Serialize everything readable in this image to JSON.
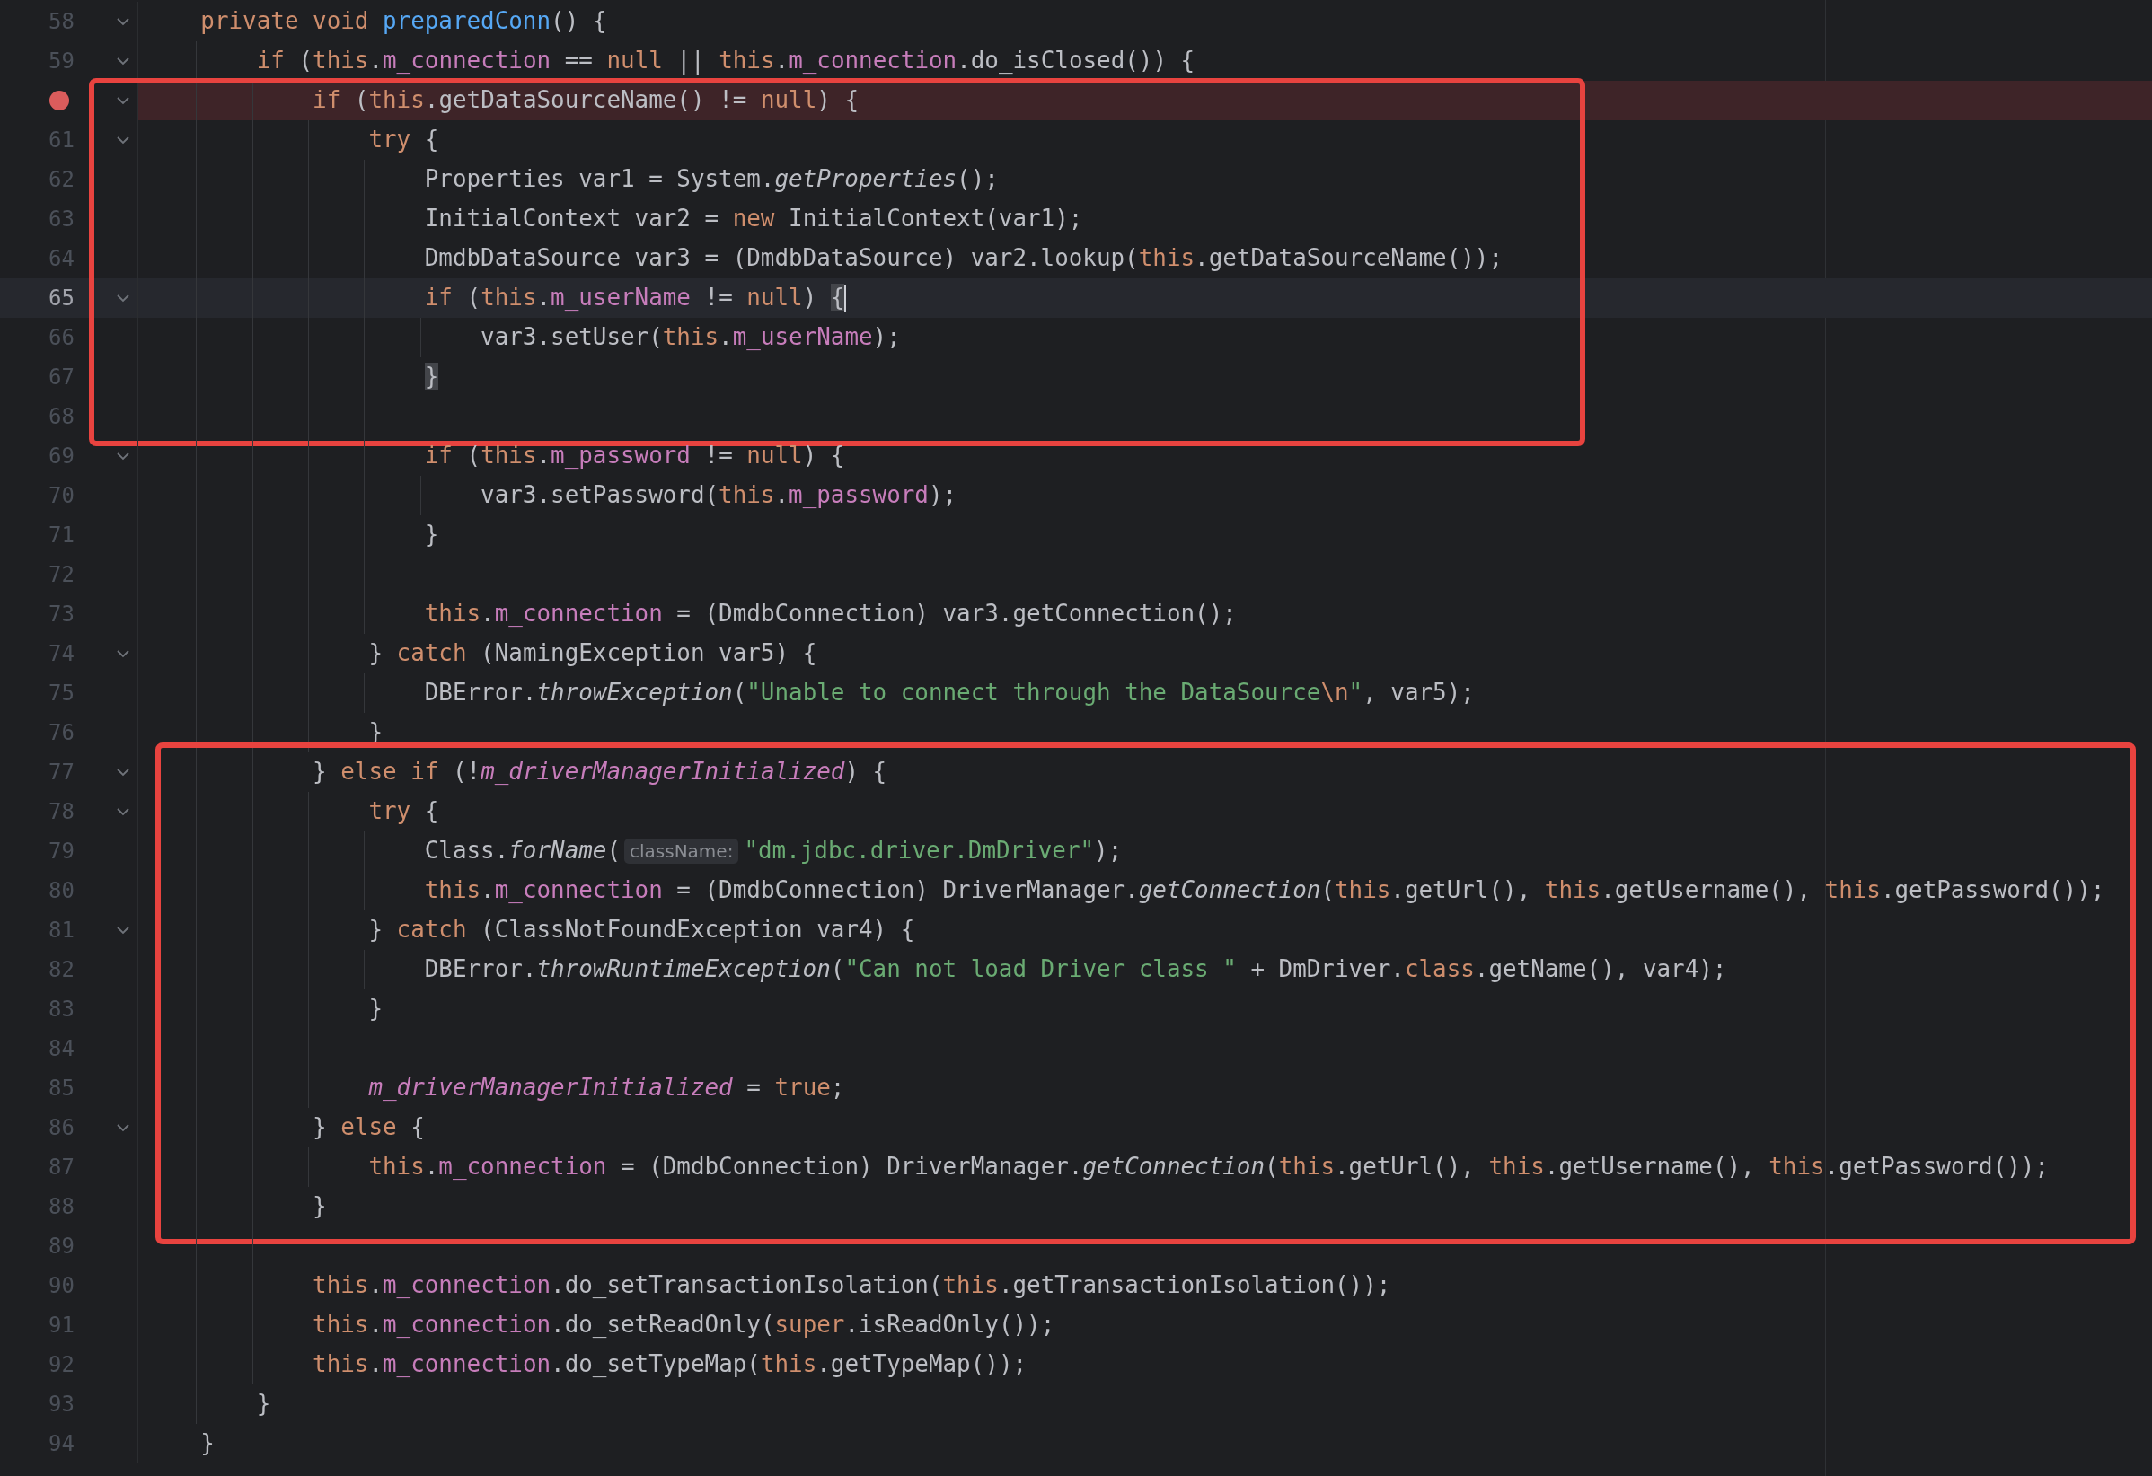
{
  "editor": {
    "blocks": [
      {
        "lines": [
          {
            "number": "58",
            "fold": true,
            "tokens": [
              {
                "text": "    private void ",
                "kind": "keyword"
              },
              {
                "text": "preparedConn",
                "kind": "declaration"
              },
              {
                "text": "() {",
                "kind": "plain"
              }
            ]
          },
          {
            "number": "59",
            "fold": true,
            "tokens": [
              {
                "text": "        if",
                "kind": "keyword"
              },
              {
                "text": " (",
                "kind": "plain"
              },
              {
                "text": "this",
                "kind": "keyword"
              },
              {
                "text": ".m_connection",
                "kind": "field-access"
              },
              {
                "text": " == ",
                "kind": "plain"
              },
              {
                "text": "null",
                "kind": "keyword"
              },
              {
                "text": " || ",
                "kind": "plain"
              },
              {
                "text": "this",
                "kind": "keyword"
              },
              {
                "text": ".m_connection",
                "kind": "field-access"
              },
              {
                "text": ".do_isClosed()) {",
                "kind": "plain"
              }
            ]
          }
        ]
      },
      {
        "kind": "inset-box",
        "lines": [
          {
            "breakpoint": true,
            "fold": true,
            "tokens": [
              {
                "text": "            if",
                "kind": "keyword"
              },
              {
                "text": " (",
                "kind": "plain"
              },
              {
                "text": "this",
                "kind": "keyword"
              },
              {
                "text": ".getDataSourceName() != ",
                "kind": "plain"
              },
              {
                "text": "null",
                "kind": "keyword"
              },
              {
                "text": ") {",
                "kind": "plain"
              }
            ]
          },
          {
            "number": "61",
            "fold": true,
            "tokens": [
              {
                "text": "                try",
                "kind": "keyword"
              },
              {
                "text": " {",
                "kind": "plain"
              }
            ]
          },
          {
            "number": "62",
            "fold": false,
            "tokens": [
              {
                "text": "                    Properties var1 = System.",
                "kind": "plain"
              },
              {
                "text": "getProperties",
                "kind": "static-call"
              },
              {
                "text": "();",
                "kind": "plain"
              }
            ]
          },
          {
            "number": "63",
            "fold": false,
            "tokens": [
              {
                "text": "                    InitialContext var2 = ",
                "kind": "plain"
              },
              {
                "text": "new",
                "kind": "keyword"
              },
              {
                "text": " InitialContext(var1);",
                "kind": "plain"
              }
            ]
          },
          {
            "number": "64",
            "fold": false,
            "tokens": [
              {
                "text": "                    DmdbDataSource var3 = (DmdbDataSource) var2.lookup(",
                "kind": "plain"
              },
              {
                "text": "this",
                "kind": "keyword"
              },
              {
                "text": ".getDataSourceName());",
                "kind": "plain"
              }
            ]
          },
          {
            "number": "65",
            "fold": true,
            "current": true,
            "caret": true,
            "tokens": [
              {
                "text": "                    if",
                "kind": "keyword"
              },
              {
                "text": " (",
                "kind": "plain"
              },
              {
                "text": "this",
                "kind": "keyword"
              },
              {
                "text": ".m_userName",
                "kind": "field-access"
              },
              {
                "text": " != ",
                "kind": "plain"
              },
              {
                "text": "null",
                "kind": "keyword"
              },
              {
                "text": ") ",
                "kind": "plain"
              },
              {
                "text": "{",
                "kind": "brace-match"
              }
            ]
          },
          {
            "number": "66",
            "fold": false,
            "tokens": [
              {
                "text": "                        var3.setUser(",
                "kind": "plain"
              },
              {
                "text": "this",
                "kind": "keyword"
              },
              {
                "text": ".m_userName",
                "kind": "field-access"
              },
              {
                "text": ");",
                "kind": "plain"
              }
            ]
          },
          {
            "number": "67",
            "fold": false,
            "tokens": [
              {
                "text": "                    }",
                "kind": "brace-match"
              }
            ]
          },
          {
            "number": "68",
            "fold": false
          }
        ]
      },
      {
        "lines": [
          {
            "number": "69",
            "fold": true,
            "tokens": [
              {
                "text": "                    if",
                "kind": "keyword"
              },
              {
                "text": " (",
                "kind": "plain"
              },
              {
                "text": "this",
                "kind": "keyword"
              },
              {
                "text": ".m_password",
                "kind": "field-access"
              },
              {
                "text": " != ",
                "kind": "plain"
              },
              {
                "text": "null",
                "kind": "keyword"
              },
              {
                "text": ") {",
                "kind": "plain"
              }
            ]
          },
          {
            "number": "70",
            "fold": false,
            "tokens": [
              {
                "text": "                        var3.setPassword(",
                "kind": "plain"
              },
              {
                "text": "this",
                "kind": "keyword"
              },
              {
                "text": ".m_password",
                "kind": "field-access"
              },
              {
                "text": ");",
                "kind": "plain"
              }
            ]
          },
          {
            "number": "71",
            "fold": false,
            "tokens": [
              {
                "text": "                    }",
                "kind": "plain"
              }
            ]
          },
          {
            "number": "72",
            "fold": false
          },
          {
            "number": "73",
            "fold": false,
            "tokens": [
              {
                "text": "                    this",
                "kind": "keyword"
              },
              {
                "text": ".m_connection",
                "kind": "field-access"
              },
              {
                "text": " = (DmdbConnection) var3.getConnection();",
                "kind": "plain"
              }
            ]
          },
          {
            "number": "74",
            "fold": true,
            "tokens": [
              {
                "text": "                } ",
                "kind": "plain"
              },
              {
                "text": "catch",
                "kind": "keyword"
              },
              {
                "text": " (NamingException var5) {",
                "kind": "plain"
              }
            ]
          },
          {
            "number": "75",
            "fold": false,
            "tokens": [
              {
                "text": "                    DBError.",
                "kind": "plain"
              },
              {
                "text": "throwException",
                "kind": "static-call"
              },
              {
                "text": "(",
                "kind": "plain"
              },
              {
                "text": "\"Unable to connect through the DataSource",
                "kind": "string"
              },
              {
                "text": "\\n",
                "kind": "escape"
              },
              {
                "text": "\"",
                "kind": "string"
              },
              {
                "text": ", var5);",
                "kind": "plain"
              }
            ]
          },
          {
            "number": "76",
            "fold": false,
            "tokens": [
              {
                "text": "                }",
                "kind": "plain"
              }
            ]
          }
        ]
      },
      {
        "kind": "wide-box",
        "lines": [
          {
            "number": "77",
            "fold": true,
            "tokens": [
              {
                "text": "            } ",
                "kind": "plain"
              },
              {
                "text": "else if",
                "kind": "keyword"
              },
              {
                "text": " (!",
                "kind": "plain"
              },
              {
                "text": "m_driverManagerInitialized",
                "kind": "static-field"
              },
              {
                "text": ") {",
                "kind": "plain"
              }
            ]
          },
          {
            "number": "78",
            "fold": true,
            "tokens": [
              {
                "text": "                try",
                "kind": "keyword"
              },
              {
                "text": " {",
                "kind": "plain"
              }
            ]
          },
          {
            "number": "79",
            "fold": false,
            "tokens": [
              {
                "text": "                    Class.",
                "kind": "plain"
              },
              {
                "text": "forName",
                "kind": "static-call"
              },
              {
                "text": "(",
                "kind": "plain"
              },
              {
                "text": "className:",
                "kind": "hint"
              },
              {
                "text": "\"dm.jdbc.driver.DmDriver\"",
                "kind": "string"
              },
              {
                "text": ");",
                "kind": "plain"
              }
            ]
          },
          {
            "number": "80",
            "fold": false,
            "tokens": [
              {
                "text": "                    this",
                "kind": "keyword"
              },
              {
                "text": ".m_connection",
                "kind": "field-access"
              },
              {
                "text": " = (DmdbConnection) DriverManager.",
                "kind": "plain"
              },
              {
                "text": "getConnection",
                "kind": "static-call"
              },
              {
                "text": "(",
                "kind": "plain"
              },
              {
                "text": "this",
                "kind": "keyword"
              },
              {
                "text": ".getUrl(), ",
                "kind": "plain"
              },
              {
                "text": "this",
                "kind": "keyword"
              },
              {
                "text": ".getUsername(), ",
                "kind": "plain"
              },
              {
                "text": "this",
                "kind": "keyword"
              },
              {
                "text": ".getPassword());",
                "kind": "plain"
              }
            ]
          },
          {
            "number": "81",
            "fold": true,
            "tokens": [
              {
                "text": "                } ",
                "kind": "plain"
              },
              {
                "text": "catch",
                "kind": "keyword"
              },
              {
                "text": " (ClassNotFoundException var4) {",
                "kind": "plain"
              }
            ]
          },
          {
            "number": "82",
            "fold": false,
            "tokens": [
              {
                "text": "                    DBError.",
                "kind": "plain"
              },
              {
                "text": "throwRuntimeException",
                "kind": "static-call"
              },
              {
                "text": "(",
                "kind": "plain"
              },
              {
                "text": "\"Can not load Driver class \"",
                "kind": "string"
              },
              {
                "text": " + DmDriver.",
                "kind": "plain"
              },
              {
                "text": "class",
                "kind": "keyword"
              },
              {
                "text": ".getName(), var4);",
                "kind": "plain"
              }
            ]
          },
          {
            "number": "83",
            "fold": false,
            "tokens": [
              {
                "text": "                }",
                "kind": "plain"
              }
            ]
          },
          {
            "number": "84",
            "fold": false
          },
          {
            "number": "85",
            "fold": false,
            "tokens": [
              {
                "text": "                m_driverManagerInitialized",
                "kind": "static-field"
              },
              {
                "text": " = ",
                "kind": "plain"
              },
              {
                "text": "true",
                "kind": "keyword"
              },
              {
                "text": ";",
                "kind": "plain"
              }
            ]
          },
          {
            "number": "86",
            "fold": true,
            "tokens": [
              {
                "text": "            } ",
                "kind": "plain"
              },
              {
                "text": "else",
                "kind": "keyword"
              },
              {
                "text": " {",
                "kind": "plain"
              }
            ]
          },
          {
            "number": "87",
            "fold": false,
            "tokens": [
              {
                "text": "                this",
                "kind": "keyword"
              },
              {
                "text": ".m_connection",
                "kind": "field-access"
              },
              {
                "text": " = (DmdbConnection) DriverManager.",
                "kind": "plain"
              },
              {
                "text": "getConnection",
                "kind": "static-call"
              },
              {
                "text": "(",
                "kind": "plain"
              },
              {
                "text": "this",
                "kind": "keyword"
              },
              {
                "text": ".getUrl(), ",
                "kind": "plain"
              },
              {
                "text": "this",
                "kind": "keyword"
              },
              {
                "text": ".getUsername(), ",
                "kind": "plain"
              },
              {
                "text": "this",
                "kind": "keyword"
              },
              {
                "text": ".getPassword());",
                "kind": "plain"
              }
            ]
          },
          {
            "number": "88",
            "fold": false,
            "tokens": [
              {
                "text": "            }",
                "kind": "plain"
              }
            ]
          }
        ]
      },
      {
        "lines": [
          {
            "number": "89",
            "fold": false
          },
          {
            "number": "90",
            "fold": false,
            "tokens": [
              {
                "text": "            this",
                "kind": "keyword"
              },
              {
                "text": ".m_connection",
                "kind": "field-access"
              },
              {
                "text": ".do_setTransactionIsolation(",
                "kind": "plain"
              },
              {
                "text": "this",
                "kind": "keyword"
              },
              {
                "text": ".getTransactionIsolation());",
                "kind": "plain"
              }
            ]
          },
          {
            "number": "91",
            "fold": false,
            "tokens": [
              {
                "text": "            this",
                "kind": "keyword"
              },
              {
                "text": ".m_connection",
                "kind": "field-access"
              },
              {
                "text": ".do_setReadOnly(",
                "kind": "plain"
              },
              {
                "text": "super",
                "kind": "keyword"
              },
              {
                "text": ".isReadOnly());",
                "kind": "plain"
              }
            ]
          },
          {
            "number": "92",
            "fold": false,
            "tokens": [
              {
                "text": "            this",
                "kind": "keyword"
              },
              {
                "text": ".m_connection",
                "kind": "field-access"
              },
              {
                "text": ".do_setTypeMap(",
                "kind": "plain"
              },
              {
                "text": "this",
                "kind": "keyword"
              },
              {
                "text": ".getTypeMap());",
                "kind": "plain"
              }
            ]
          },
          {
            "number": "93",
            "fold": false,
            "tokens": [
              {
                "text": "        }",
                "kind": "plain"
              }
            ]
          },
          {
            "number": "94",
            "fold": false,
            "tokens": [
              {
                "text": "    }",
                "kind": "plain"
              }
            ]
          }
        ]
      }
    ]
  }
}
